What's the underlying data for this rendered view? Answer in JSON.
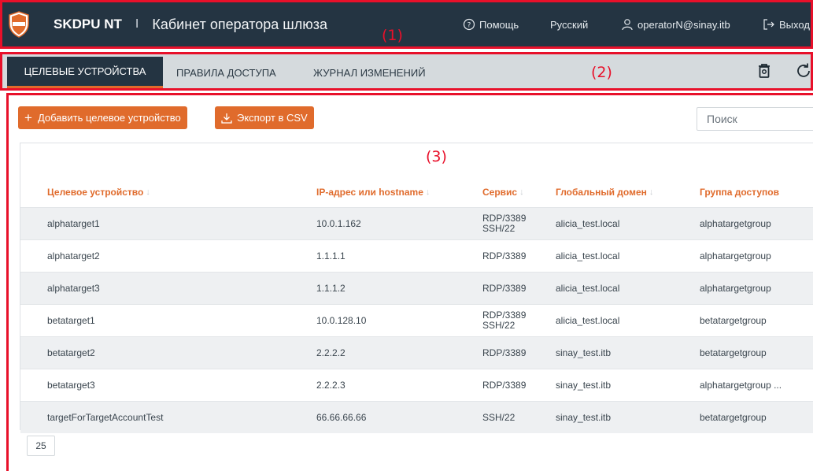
{
  "header": {
    "app_name": "SKDPU NT",
    "separator": "I",
    "page_title": "Кабинет оператора шлюза",
    "annotation": "(1)",
    "help": "Помощь",
    "language": "Русский",
    "user": "operatorN@sinay.itb",
    "logout": "Выход",
    "logo_text": "SKDPU"
  },
  "tabs": {
    "items": [
      "ЦЕЛЕВЫЕ УСТРОЙСТВА",
      "ПРАВИЛА ДОСТУПА",
      "ЖУРНАЛ ИЗМЕНЕНИЙ"
    ],
    "active": "ЦЕЛЕВЫЕ УСТРОЙСТВА",
    "annotation": "(2)",
    "icons": [
      "trash-icon",
      "refresh-icon"
    ]
  },
  "toolbar": {
    "add_label": "Добавить целевое устройство",
    "export_label": "Экспорт в CSV",
    "search_placeholder": "Поиск"
  },
  "table": {
    "annotation": "(3)",
    "columns": [
      "Целевое устройство",
      "IP-адрес или hostname",
      "Сервис",
      "Глобальный домен",
      "Группа доступов"
    ],
    "rows": [
      {
        "device": "alphatarget1",
        "ip": "10.0.1.162",
        "service": [
          "RDP/3389",
          "SSH/22"
        ],
        "domain": "alicia_test.local",
        "group": "alphatargetgroup"
      },
      {
        "device": "alphatarget2",
        "ip": "1.1.1.1",
        "service": [
          "RDP/3389"
        ],
        "domain": "alicia_test.local",
        "group": "alphatargetgroup"
      },
      {
        "device": "alphatarget3",
        "ip": "1.1.1.2",
        "service": [
          "RDP/3389"
        ],
        "domain": "alicia_test.local",
        "group": "alphatargetgroup"
      },
      {
        "device": "betatarget1",
        "ip": "10.0.128.10",
        "service": [
          "RDP/3389",
          "SSH/22"
        ],
        "domain": "alicia_test.local",
        "group": "betatargetgroup"
      },
      {
        "device": "betatarget2",
        "ip": "2.2.2.2",
        "service": [
          "RDP/3389"
        ],
        "domain": "sinay_test.itb",
        "group": "betatargetgroup"
      },
      {
        "device": "betatarget3",
        "ip": "2.2.2.3",
        "service": [
          "RDP/3389"
        ],
        "domain": "sinay_test.itb",
        "group": "alphatargetgroup ..."
      },
      {
        "device": "targetForTargetAccountTest",
        "ip": "66.66.66.66",
        "service": [
          "SSH/22"
        ],
        "domain": "sinay_test.itb",
        "group": "betatargetgroup"
      }
    ]
  },
  "pagination": {
    "page_size": "25"
  },
  "colors": {
    "header_bg": "#243442",
    "accent": "#e06b2c",
    "annotation": "#e8102a",
    "tabbar_bg": "#d5dadd"
  }
}
